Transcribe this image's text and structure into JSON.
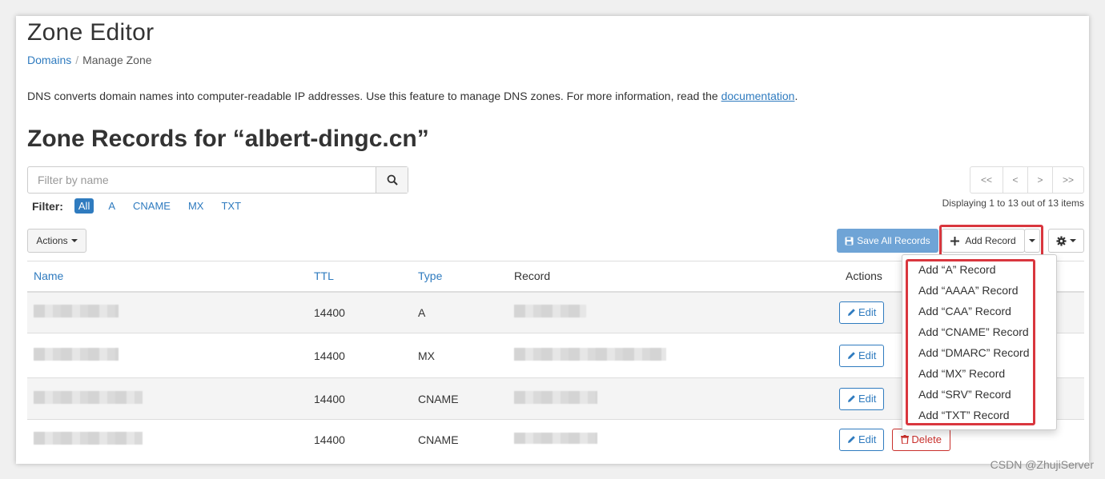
{
  "page": {
    "title": "Zone Editor",
    "breadcrumb": [
      "Domains",
      "Manage Zone"
    ],
    "description_text": "DNS converts domain names into computer-readable IP addresses. Use this feature to manage DNS zones. For more information, read the ",
    "description_link": "documentation",
    "description_end": ".",
    "zone_title": "Zone Records for “albert-dingc.cn”"
  },
  "search": {
    "placeholder": "Filter by name"
  },
  "filter": {
    "label": "Filter:",
    "options": [
      "All",
      "A",
      "CNAME",
      "MX",
      "TXT"
    ],
    "active": "All"
  },
  "pager": {
    "first": "<<",
    "prev": "<",
    "next": ">",
    "last": ">>",
    "info": "Displaying 1 to 13 out of 13 items"
  },
  "toolbar": {
    "actions": "Actions",
    "save_all": "Save All Records",
    "add_record": "Add Record"
  },
  "table": {
    "headers": [
      "Name",
      "TTL",
      "Type",
      "Record",
      "Actions"
    ],
    "rows": [
      {
        "ttl": "14400",
        "type": "A"
      },
      {
        "ttl": "14400",
        "type": "MX"
      },
      {
        "ttl": "14400",
        "type": "CNAME"
      },
      {
        "ttl": "14400",
        "type": "CNAME"
      }
    ],
    "edit_label": "Edit",
    "delete_label": "Delete"
  },
  "add_menu": [
    "Add “A” Record",
    "Add “AAAA” Record",
    "Add “CAA” Record",
    "Add “CNAME” Record",
    "Add “DMARC” Record",
    "Add “MX” Record",
    "Add “SRV” Record",
    "Add “TXT” Record"
  ],
  "watermark": "CSDN @ZhujiServer",
  "colors": {
    "link": "#2f7bbf",
    "save_button": "#6fa4d6",
    "delete": "#c9302c",
    "highlight": "#d9363e"
  },
  "icons": [
    "search-icon",
    "save-icon",
    "plus-icon",
    "gear-icon",
    "pencil-icon",
    "trash-icon"
  ]
}
